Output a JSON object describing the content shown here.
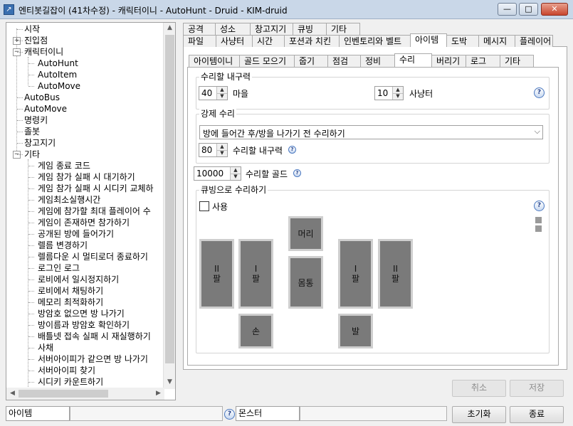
{
  "window": {
    "title": "엔티봇길잡이 (41차수정) - 캐릭터이니 - AutoHunt - Druid - KIM-druid",
    "minimize": "—",
    "maximize": "□",
    "close": "✕"
  },
  "tree": {
    "items": [
      {
        "label": "시작"
      },
      {
        "label": "진입점"
      },
      {
        "label": "캐릭터이니"
      },
      {
        "label": "AutoHunt"
      },
      {
        "label": "AutoItem"
      },
      {
        "label": "AutoMove"
      },
      {
        "label": "AutoBus"
      },
      {
        "label": "AutoMove"
      },
      {
        "label": "명령키"
      },
      {
        "label": "졸봇"
      },
      {
        "label": "창고지기"
      },
      {
        "label": "기타"
      },
      {
        "label": "게임 종료 코드"
      },
      {
        "label": "게임 참가 실패 시 대기하기"
      },
      {
        "label": "게임 참가 실패 시 시디키 교체하"
      },
      {
        "label": "게임최소실행시간"
      },
      {
        "label": "게임에 참가할 최대 플레이어 수"
      },
      {
        "label": "게임이 존재하면 참가하기"
      },
      {
        "label": "공개된 방에 들어가기"
      },
      {
        "label": "렐름 변경하기"
      },
      {
        "label": "렐름다운 시 멀티로더 종료하기"
      },
      {
        "label": "로그인 로그"
      },
      {
        "label": "로비에서 일시정지하기"
      },
      {
        "label": "로비에서 채팅하기"
      },
      {
        "label": "메모리 최적화하기"
      },
      {
        "label": "방암호 없으면 방 나가기"
      },
      {
        "label": "방이름과 방암호 확인하기"
      },
      {
        "label": "배틀넷 접속 실패 시 재실행하기"
      },
      {
        "label": "사채"
      },
      {
        "label": "서버아이피가 같으면 방 나가기"
      },
      {
        "label": "서버아이피 찾기"
      },
      {
        "label": "시디키 카운트하기"
      }
    ]
  },
  "tabs_row1": [
    "공격",
    "성소",
    "창고지기",
    "큐빙",
    "기타"
  ],
  "tabs_row2": [
    "파일",
    "사냥터",
    "시간",
    "포션과 치킨",
    "인벤토리와 벨트",
    "아이템",
    "도박",
    "메시지",
    "플레이어"
  ],
  "subtabs": [
    "아이템이니",
    "골드 모으기",
    "줍기",
    "점검",
    "정비",
    "수리",
    "버리기",
    "로그",
    "기타"
  ],
  "repair": {
    "group_title": "수리할 내구력",
    "village_value": "40",
    "village_label": "마을",
    "hunt_value": "10",
    "hunt_label": "사냥터"
  },
  "force_repair": {
    "group_title": "강제 수리",
    "combo_value": "방에 들어간 후/방을 나가기 전 수리하기",
    "durability_value": "80",
    "durability_label": "수리할 내구력"
  },
  "gold": {
    "value": "10000",
    "label": "수리할 골드"
  },
  "cube_repair": {
    "group_title": "큐빙으로 수리하기",
    "use_label": "사용",
    "slots": {
      "head": "머리",
      "body": "몸통",
      "arm_left_2": "II\n팔",
      "arm_left_1": "I\n팔",
      "arm_right_1": "I\n팔",
      "arm_right_2": "II\n팔",
      "hand": "손",
      "foot": "발"
    }
  },
  "buttons": {
    "cancel": "취소",
    "save": "저장",
    "reset": "초기화",
    "close": "종료"
  },
  "status": {
    "item_field": "아이템",
    "monster_field": "몬스터"
  },
  "help_glyph": "?",
  "scroll": {
    "up": "▲",
    "down": "▼",
    "left": "◀",
    "right": "▶"
  }
}
